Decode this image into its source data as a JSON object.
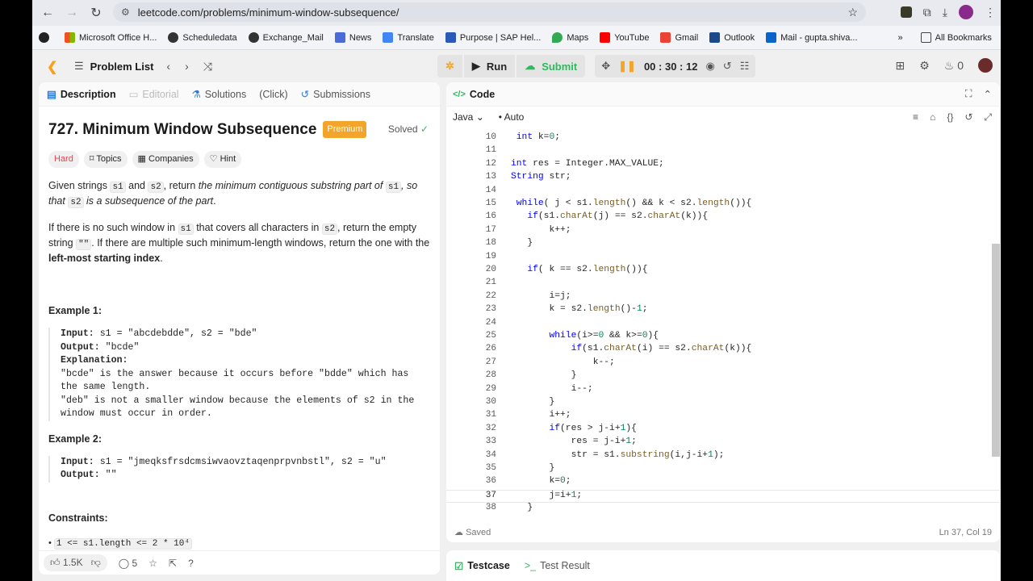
{
  "browser": {
    "url": "leetcode.com/problems/minimum-window-subsequence/",
    "bookmarks": [
      "Microsoft Office H...",
      "Scheduledata",
      "Exchange_Mail",
      "News",
      "Translate",
      "Purpose | SAP Hel...",
      "Maps",
      "YouTube",
      "Gmail",
      "Outlook",
      "Mail - gupta.shiva..."
    ],
    "all_bookmarks": "All Bookmarks",
    "more": "»"
  },
  "header": {
    "problem_list": "Problem List",
    "run": "Run",
    "submit": "Submit",
    "timer": "00 : 30 : 12",
    "streak": "0"
  },
  "tabs": {
    "description": "Description",
    "editorial": "Editorial",
    "solutions": "Solutions",
    "click": "(Click)",
    "submissions": "Submissions"
  },
  "problem": {
    "title": "727. Minimum Window Subsequence",
    "premium": "Premium",
    "solved": "Solved",
    "difficulty": "Hard",
    "chips": [
      "Topics",
      "Companies",
      "Hint"
    ],
    "p1_a": "Given strings",
    "p1_b": "and",
    "p1_c": ", return",
    "p1_d": "the minimum contiguous substring part of",
    "p1_e": ", so that",
    "p1_f": "is a subsequence of the part",
    "p1_g": ".",
    "s1": "s1",
    "s2": "s2",
    "p2_a": "If there is no such window in",
    "p2_b": "that covers all characters in",
    "p2_c": ", return the empty string",
    "p2_empty": "\"\"",
    "p2_d": ". If there are multiple such minimum-length windows, return the one with the",
    "p2_bold": "left-most starting index",
    "p2_e": ".",
    "example1_title": "Example 1:",
    "example1_lines": [
      [
        "Input:",
        " s1 = \"abcdebdde\", s2 = \"bde\""
      ],
      [
        "Output:",
        " \"bcde\""
      ],
      [
        "Explanation:",
        ""
      ],
      [
        "",
        "\"bcde\" is the answer because it occurs before \"bdde\" which has"
      ],
      [
        "",
        "the same length."
      ],
      [
        "",
        "\"deb\" is not a smaller window because the elements of s2 in the"
      ],
      [
        "",
        "window must occur in order."
      ]
    ],
    "example2_title": "Example 2:",
    "example2_lines": [
      [
        "Input:",
        " s1 = \"jmeqksfrsdcmsiwvaovztaqenprpvnbstl\", s2 = \"u\""
      ],
      [
        "Output:",
        " \"\""
      ]
    ],
    "constraints_title": "Constraints:",
    "constraint_1": "1 <= s1.length <= 2 * 10⁴"
  },
  "footer": {
    "likes": "1.5K",
    "comments": "5"
  },
  "editor": {
    "title": "Code",
    "language": "Java",
    "mode": "Auto",
    "status": "Saved",
    "cursor": "Ln 37, Col 19",
    "lines": [
      {
        "n": "10",
        "t": " int k=0;"
      },
      {
        "n": "11",
        "t": ""
      },
      {
        "n": "12",
        "t": "int res = Integer.MAX_VALUE;"
      },
      {
        "n": "13",
        "t": "String str;"
      },
      {
        "n": "14",
        "t": ""
      },
      {
        "n": "15",
        "t": " while( j < s1.length() && k < s2.length()){"
      },
      {
        "n": "16",
        "t": "   if(s1.charAt(j) == s2.charAt(k)){"
      },
      {
        "n": "17",
        "t": "       k++;"
      },
      {
        "n": "18",
        "t": "   }"
      },
      {
        "n": "19",
        "t": ""
      },
      {
        "n": "20",
        "t": "   if( k == s2.length()){"
      },
      {
        "n": "21",
        "t": ""
      },
      {
        "n": "22",
        "t": "       i=j;"
      },
      {
        "n": "23",
        "t": "       k = s2.length()-1;"
      },
      {
        "n": "24",
        "t": ""
      },
      {
        "n": "25",
        "t": "       while(i>=0 && k>=0){"
      },
      {
        "n": "26",
        "t": "           if(s1.charAt(i) == s2.charAt(k)){"
      },
      {
        "n": "27",
        "t": "               k--;"
      },
      {
        "n": "28",
        "t": "           }"
      },
      {
        "n": "29",
        "t": "           i--;"
      },
      {
        "n": "30",
        "t": "       }"
      },
      {
        "n": "31",
        "t": "       i++;"
      },
      {
        "n": "32",
        "t": "       if(res > j-i+1){"
      },
      {
        "n": "33",
        "t": "           res = j-i+1;"
      },
      {
        "n": "34",
        "t": "           str = s1.substring(i,j-i+1);"
      },
      {
        "n": "35",
        "t": "       }"
      },
      {
        "n": "36",
        "t": "       k=0;"
      },
      {
        "n": "37",
        "t": "       j=i+1;"
      },
      {
        "n": "38",
        "t": "   }"
      }
    ]
  },
  "bottom": {
    "testcase": "Testcase",
    "test_result": "Test Result"
  }
}
